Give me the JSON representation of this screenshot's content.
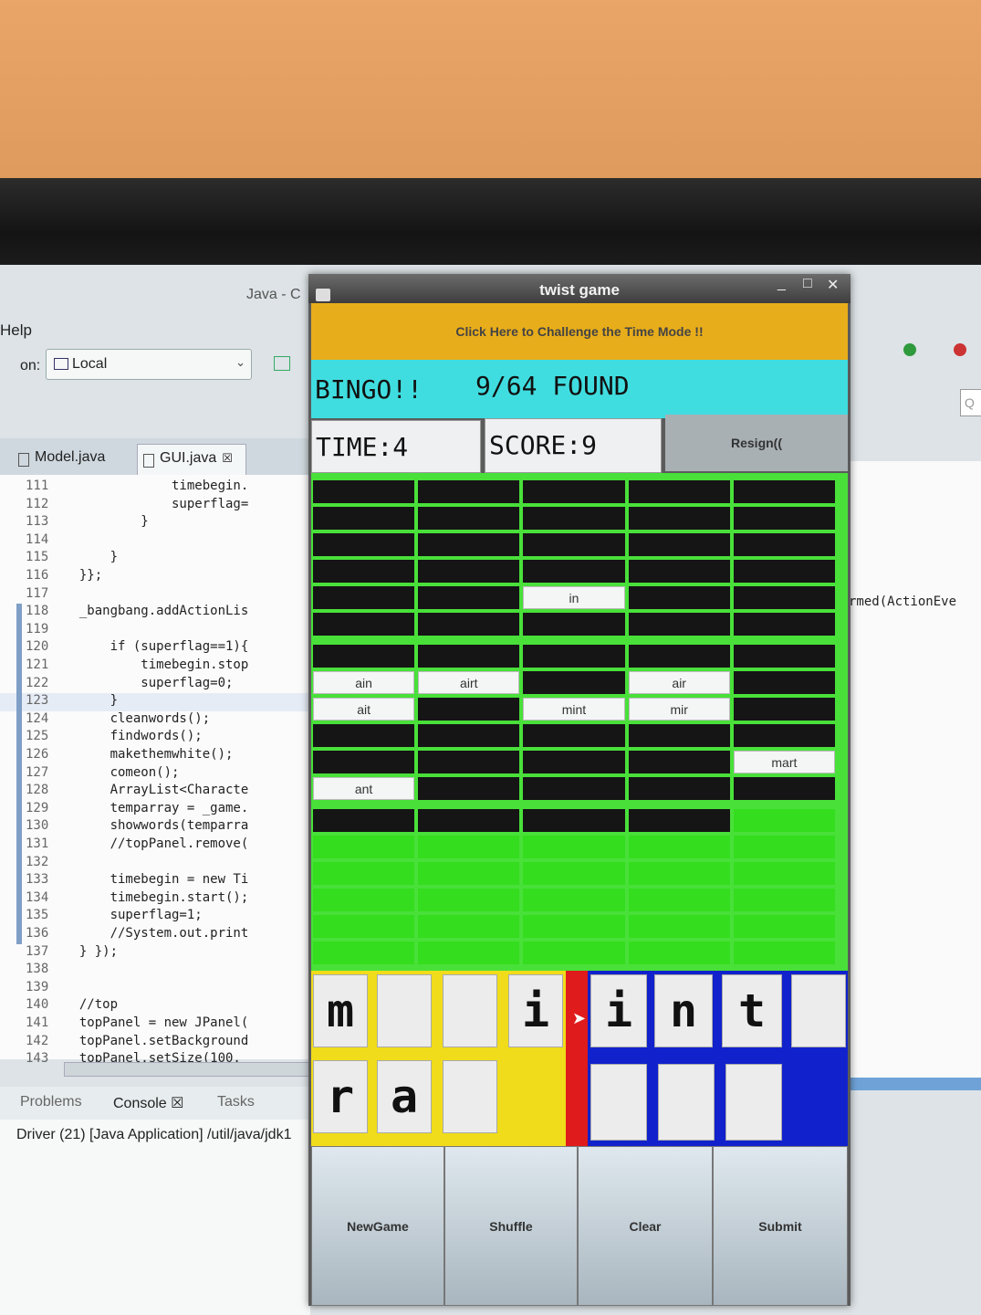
{
  "eclipse": {
    "window_title": "Java - C",
    "menu_help": "Help",
    "run_on_label": "on:",
    "run_on_value": "Local",
    "tabs": [
      {
        "label": "Model.java"
      },
      {
        "label": "GUI.java",
        "close": "☒"
      }
    ],
    "line_numbers": [
      "111",
      "112",
      "113",
      "114",
      "115",
      "116",
      "117",
      "118",
      "119",
      "120",
      "121",
      "122",
      "123",
      "124",
      "125",
      "126",
      "127",
      "128",
      "129",
      "130",
      "131",
      "132",
      "133",
      "134",
      "135",
      "136",
      "137",
      "138",
      "139",
      "140",
      "141",
      "142",
      "143"
    ],
    "code_lines": [
      "              timebegin.",
      "              superflag=",
      "          }",
      "",
      "      }",
      "  }};",
      "",
      "  _bangbang.addActionLis",
      "",
      "      if (superflag==1){",
      "          timebegin.stop",
      "          superflag=0;",
      "      }",
      "      cleanwords();",
      "      findwords();",
      "      makethemwhite();",
      "      comeon();",
      "      ArrayList<Characte",
      "      temparray = _game.",
      "      showwords(temparra",
      "      //topPanel.remove(",
      "",
      "      timebegin = new Ti",
      "      timebegin.start();",
      "      superflag=1;",
      "      //System.out.print",
      "  } });",
      "",
      "",
      "  //top",
      "  topPanel = new JPanel(",
      "  topPanel.setBackground",
      "  topPanel.setSize(100."
    ],
    "right_code_fragment": "rmed(ActionEve",
    "search_placeholder": "Q",
    "console_tabs": [
      {
        "label": "Problems"
      },
      {
        "label": "Console",
        "close": "☒"
      },
      {
        "label": "Tasks"
      }
    ],
    "console_line": "Driver (21) [Java Application] /util/java/jdk1"
  },
  "game": {
    "title": "twist game",
    "window_controls": [
      "_",
      "□",
      "✕"
    ],
    "challenge_label": "Click Here to Challenge the Time Mode !!",
    "status_bingo": "BINGO!!",
    "status_found": "9/64 FOUND",
    "time": "TIME:4",
    "score": "SCORE:9",
    "resign_label": "Resign((",
    "found_words": {
      "in": "in",
      "ain": "ain",
      "airt": "airt",
      "air": "air",
      "ait": "ait",
      "mint": "mint",
      "mir": "mir",
      "mart": "mart",
      "ant": "ant"
    },
    "tiles_row1": [
      "m",
      "",
      "",
      "i",
      "i",
      "n",
      "t",
      ""
    ],
    "tiles_row2": [
      "r",
      "a",
      "",
      "",
      "",
      ""
    ],
    "buttons": [
      "NewGame",
      "Shuffle",
      "Clear",
      "Submit"
    ],
    "colors": {
      "challenge_bg": "#e8ad1b",
      "status_bg": "#40dde0",
      "grid_green": "#34dd1e",
      "letter_area_yellow": "#f0dc1a",
      "divider_red": "#e01b1b",
      "selected_blue": "#1122cc"
    }
  }
}
